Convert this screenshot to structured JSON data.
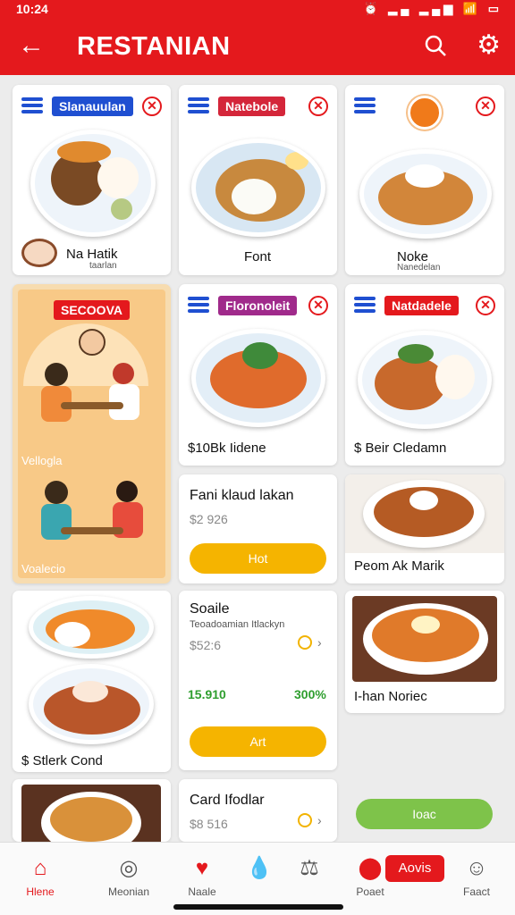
{
  "status": {
    "time": "10:24",
    "icons": "⏰ ▂▄ ▂▄▆ 📶 ▭"
  },
  "header": {
    "title": "RESTANIAN"
  },
  "cards": {
    "c1": {
      "tag": "Slanauulan",
      "name": "Na Hatik",
      "sub": "taarlan"
    },
    "c2": {
      "tag": "Natebole",
      "name": "Font"
    },
    "c3": {
      "name": "Noke",
      "sub": "Nanedelan"
    },
    "promo": {
      "badge": "SECOOVA",
      "label1": "Vellogla",
      "label2": "Voalecio"
    },
    "c5": {
      "tag": "Floronoleit",
      "name": "$10Bk Iidene"
    },
    "c6": {
      "tag": "Natdadele",
      "name": "$ Beir Cledamn"
    },
    "c7": {
      "name": "Fani klaud lakan",
      "price": "$2 926",
      "button": "Hot"
    },
    "c8": {
      "name": "Peom Ak Marik"
    },
    "c9": {
      "name": "Soaile",
      "sub": "Teoadoamian Itlackyn",
      "price": "$52:6",
      "stat1": "15.910",
      "stat2": "300%",
      "button": "Art"
    },
    "c10": {
      "name": "I-han Noriec"
    },
    "c11": {
      "name": "$ Stlerk Cond"
    },
    "c12": {
      "name": "Card Ifodlar",
      "price": "$8 516"
    },
    "green_button": "Ioac"
  },
  "nav": [
    {
      "label": "Hlene",
      "glyph": "⌂"
    },
    {
      "label": "Meonian",
      "glyph": "◎"
    },
    {
      "label": "Naale",
      "glyph": "♥"
    },
    {
      "label": "",
      "glyph": "💧"
    },
    {
      "label": "",
      "glyph": "⚖"
    },
    {
      "label": "Poaet",
      "glyph": "⬤"
    },
    {
      "label": "Faact",
      "glyph": "☺"
    }
  ],
  "nav_badge": "Aovis",
  "colors": {
    "brand": "#e4191d",
    "blue": "#1f4fd1",
    "yellow": "#f5b400",
    "green": "#7ec34a",
    "purple": "#a02a8b"
  }
}
